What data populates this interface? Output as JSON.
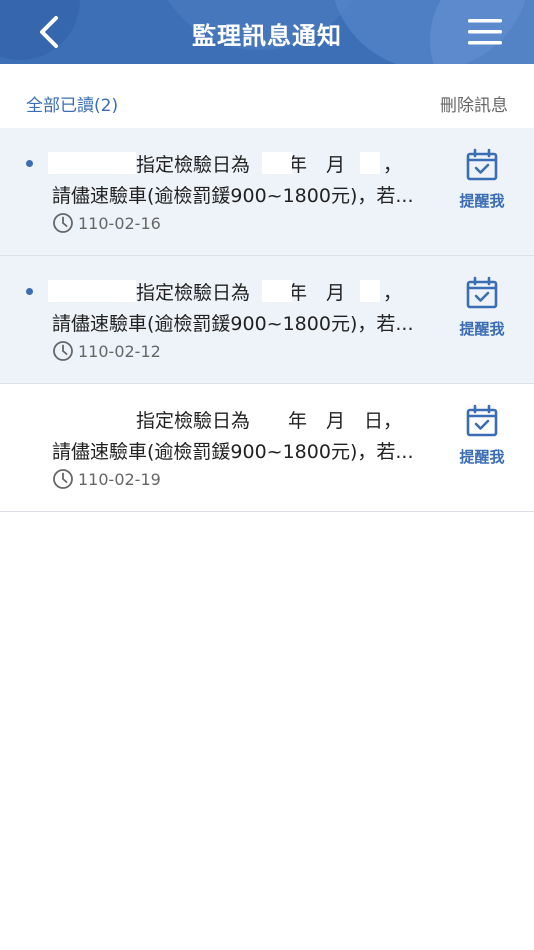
{
  "header": {
    "title": "監理訊息通知",
    "back_icon": "chevron-left-icon",
    "menu_icon": "hamburger-menu-icon"
  },
  "toolbar": {
    "read_all_label": "全部已讀(2)",
    "delete_label": "刪除訊息"
  },
  "messages": [
    {
      "line1": "指定檢驗日為　　年　月　日，",
      "line2": "請儘速驗車(逾檢罰鍰900~1800元)，若...",
      "date": "110-02-16",
      "unread": true,
      "remind_label": "提醒我"
    },
    {
      "line1": "指定檢驗日為　　年　月　日，",
      "line2": "請儘速驗車(逾檢罰鍰900~1800元)，若...",
      "date": "110-02-12",
      "unread": true,
      "remind_label": "提醒我"
    },
    {
      "line1": "指定檢驗日為　　年　月　日，",
      "line2": "請儘速驗車(逾檢罰鍰900~1800元)，若...",
      "date": "110-02-19",
      "unread": false,
      "remind_label": "提醒我"
    }
  ],
  "colors": {
    "primary": "#3d6fb6",
    "unread_bg": "#eef3fa",
    "accent_text": "#3b6db4"
  }
}
